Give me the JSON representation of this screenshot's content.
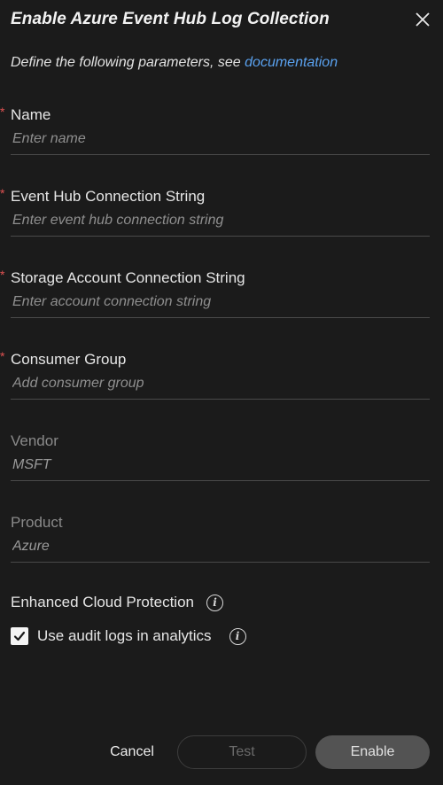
{
  "dialog": {
    "title": "Enable Azure Event Hub Log Collection",
    "subtitle_prefix": "Define the following parameters, see ",
    "documentation_link": "documentation"
  },
  "fields": {
    "name": {
      "label": "Name",
      "placeholder": "Enter name",
      "required": "*",
      "value": ""
    },
    "connection_string": {
      "label": "Event Hub Connection String",
      "placeholder": "Enter event hub connection string",
      "required": "*",
      "value": ""
    },
    "storage_string": {
      "label": "Storage Account Connection String",
      "placeholder": "Enter account connection string",
      "required": "*",
      "value": ""
    },
    "consumer_group": {
      "label": "Consumer Group",
      "placeholder": "Add consumer group",
      "required": "*",
      "value": ""
    },
    "vendor": {
      "label": "Vendor",
      "value": "MSFT"
    },
    "product": {
      "label": "Product",
      "value": "Azure"
    }
  },
  "enhanced": {
    "title": "Enhanced Cloud Protection",
    "checkbox_label": "Use audit logs in analytics",
    "checked": true
  },
  "footer": {
    "cancel": "Cancel",
    "test": "Test",
    "enable": "Enable"
  },
  "icons": {
    "close": "close-icon",
    "info": "info-icon",
    "check": "checkmark-icon"
  },
  "colors": {
    "background": "#1b1b1b",
    "link": "#5aa2f0",
    "required": "#e05252",
    "enable_button": "#535353"
  }
}
